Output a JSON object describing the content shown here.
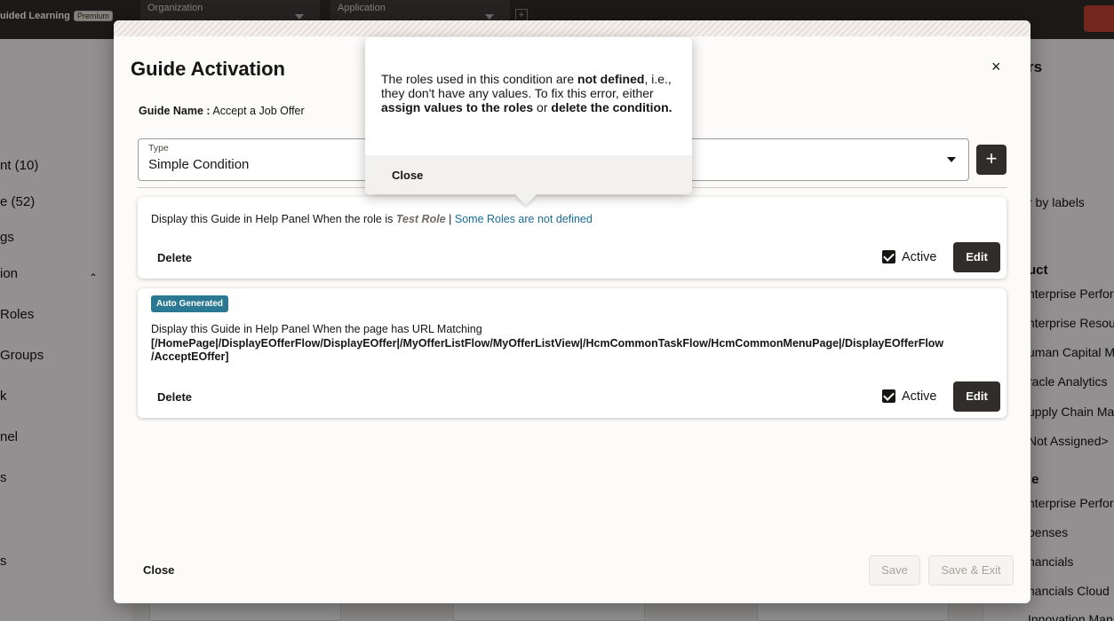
{
  "background": {
    "brand": "uided Learning",
    "brand_badge": "Premium",
    "org_label": "Organization",
    "app_label": "Application",
    "left_nav": [
      "nt (10)",
      "e (52)",
      "gs",
      "ion",
      "Roles",
      "Groups",
      "k",
      "nel",
      "s",
      "s"
    ],
    "right_panel": [
      "rs",
      "r by labels",
      "uct",
      "nterprise Perfor",
      "nterprise Resou",
      "uman Capital M",
      "racle Analytics",
      "upply Chain Ma",
      "Not Assigned>",
      "le",
      "nterprise Perfor",
      "penses",
      "nancials",
      "nancials Cloud",
      "Innovation Mana"
    ]
  },
  "dialog": {
    "title": "Guide Activation",
    "guide_name_label": "Guide Name :",
    "guide_name_value": "Accept a Job Offer",
    "type_label": "Type",
    "type_value": "Simple Condition",
    "add_label": "+",
    "close_icon": "×",
    "conditions": [
      {
        "text_prefix": "Display this Guide in Help Panel When the role is",
        "role": "Test Role",
        "separator": "|",
        "warning_link": "Some Roles are not defined",
        "delete_label": "Delete",
        "active_label": "Active",
        "edit_label": "Edit"
      },
      {
        "badge": "Auto Generated",
        "text": "Display this Guide in Help Panel When the page has URL Matching",
        "url_line1": "[/HomePage|/DisplayEOfferFlow/DisplayEOffer|/MyOfferListFlow/MyOfferListView|/HcmCommonTaskFlow/HcmCommonMenuPage|/DisplayEOfferFlow",
        "url_line2": "/AcceptEOffer]",
        "delete_label": "Delete",
        "active_label": "Active",
        "edit_label": "Edit"
      }
    ],
    "footer": {
      "close_label": "Close",
      "save_label": "Save",
      "save_exit_label": "Save & Exit"
    }
  },
  "popover": {
    "msg_1": "The roles used in this condition are ",
    "msg_bold_1": "not defined",
    "msg_2": ", i.e., they don't have any values. To fix this error, either ",
    "msg_bold_2": "assign values to the roles",
    "msg_3": " or ",
    "msg_bold_3": "delete the condition.",
    "close_label": "Close"
  }
}
